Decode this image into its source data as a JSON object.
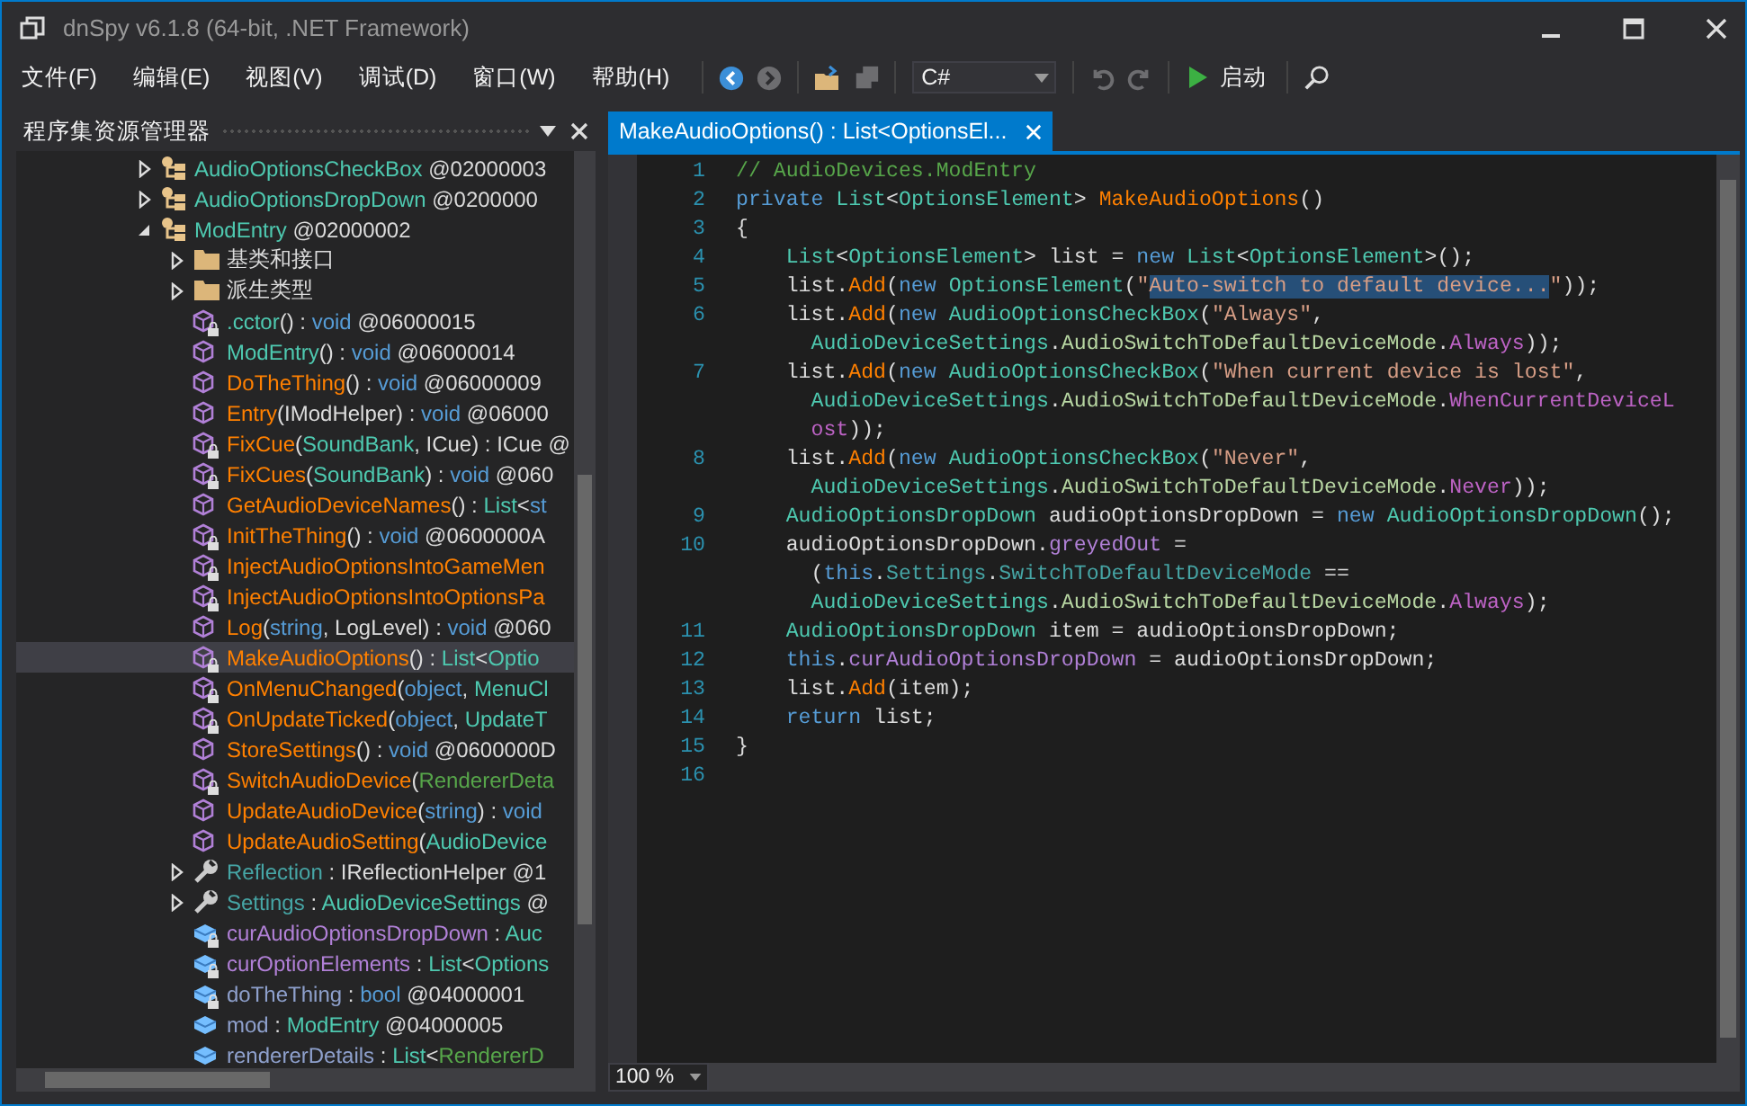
{
  "window": {
    "title": "dnSpy v6.1.8 (64-bit, .NET Framework)"
  },
  "menu": [
    "文件(F)",
    "编辑(E)",
    "视图(V)",
    "调试(D)",
    "窗口(W)",
    "帮助(H)"
  ],
  "toolbar": {
    "language": "C#",
    "start": "启动"
  },
  "explorer": {
    "title": "程序集资源管理器",
    "tree": [
      {
        "kind": "class",
        "expanded": false,
        "selected": false,
        "private": false,
        "label": [
          {
            "t": "AudioOptionsCheckBox",
            "kind": "type"
          },
          {
            "t": " @02000003",
            "kind": "plain"
          }
        ]
      },
      {
        "kind": "class",
        "expanded": false,
        "selected": false,
        "private": false,
        "label": [
          {
            "t": "AudioOptionsDropDown",
            "kind": "type"
          },
          {
            "t": " @0200000",
            "kind": "plain"
          }
        ]
      },
      {
        "kind": "class",
        "expanded": true,
        "selected": false,
        "private": false,
        "label": [
          {
            "t": "ModEntry",
            "kind": "type"
          },
          {
            "t": " @02000002",
            "kind": "plain"
          }
        ],
        "children": [
          {
            "kind": "folder",
            "expanded": false,
            "selected": false,
            "private": false,
            "label": [
              {
                "t": "基类和接口",
                "kind": "plain"
              }
            ]
          },
          {
            "kind": "folder",
            "expanded": false,
            "selected": false,
            "private": false,
            "label": [
              {
                "t": "派生类型",
                "kind": "plain"
              }
            ]
          },
          {
            "kind": "method",
            "selected": false,
            "private": true,
            "label": [
              {
                "t": ".cctor",
                "kind": "type"
              },
              {
                "t": "() : ",
                "kind": "plain"
              },
              {
                "t": "void",
                "kind": "keyword"
              },
              {
                "t": " @06000015",
                "kind": "plain"
              }
            ]
          },
          {
            "kind": "method",
            "selected": false,
            "private": false,
            "label": [
              {
                "t": "ModEntry",
                "kind": "type"
              },
              {
                "t": "() : ",
                "kind": "plain"
              },
              {
                "t": "void",
                "kind": "keyword"
              },
              {
                "t": " @06000014",
                "kind": "plain"
              }
            ]
          },
          {
            "kind": "method",
            "selected": false,
            "private": false,
            "label": [
              {
                "t": "DoTheThing",
                "kind": "method"
              },
              {
                "t": "() : ",
                "kind": "plain"
              },
              {
                "t": "void",
                "kind": "keyword"
              },
              {
                "t": " @06000009",
                "kind": "plain"
              }
            ]
          },
          {
            "kind": "method",
            "selected": false,
            "private": false,
            "label": [
              {
                "t": "Entry",
                "kind": "method"
              },
              {
                "t": "(IModHelper) : ",
                "kind": "plain"
              },
              {
                "t": "void",
                "kind": "keyword"
              },
              {
                "t": " @06000",
                "kind": "plain"
              }
            ]
          },
          {
            "kind": "method",
            "selected": false,
            "private": true,
            "label": [
              {
                "t": "FixCue",
                "kind": "method"
              },
              {
                "t": "(",
                "kind": "plain"
              },
              {
                "t": "SoundBank",
                "kind": "type"
              },
              {
                "t": ", ICue) : ICue @",
                "kind": "plain"
              }
            ]
          },
          {
            "kind": "method",
            "selected": false,
            "private": true,
            "label": [
              {
                "t": "FixCues",
                "kind": "method"
              },
              {
                "t": "(",
                "kind": "plain"
              },
              {
                "t": "SoundBank",
                "kind": "type"
              },
              {
                "t": ") : ",
                "kind": "plain"
              },
              {
                "t": "void",
                "kind": "keyword"
              },
              {
                "t": " @060",
                "kind": "plain"
              }
            ]
          },
          {
            "kind": "method",
            "selected": false,
            "private": false,
            "label": [
              {
                "t": "GetAudioDeviceNames",
                "kind": "method"
              },
              {
                "t": "() : ",
                "kind": "plain"
              },
              {
                "t": "List",
                "kind": "type"
              },
              {
                "t": "<",
                "kind": "plain"
              },
              {
                "t": "st",
                "kind": "keyword"
              }
            ]
          },
          {
            "kind": "method",
            "selected": false,
            "private": true,
            "label": [
              {
                "t": "InitTheThing",
                "kind": "method"
              },
              {
                "t": "() : ",
                "kind": "plain"
              },
              {
                "t": "void",
                "kind": "keyword"
              },
              {
                "t": " @0600000A",
                "kind": "plain"
              }
            ]
          },
          {
            "kind": "method",
            "selected": false,
            "private": true,
            "label": [
              {
                "t": "InjectAudioOptionsIntoGameMen",
                "kind": "method"
              }
            ]
          },
          {
            "kind": "method",
            "selected": false,
            "private": true,
            "label": [
              {
                "t": "InjectAudioOptionsIntoOptionsPa",
                "kind": "method"
              }
            ]
          },
          {
            "kind": "method",
            "selected": false,
            "private": false,
            "label": [
              {
                "t": "Log",
                "kind": "method"
              },
              {
                "t": "(",
                "kind": "plain"
              },
              {
                "t": "string",
                "kind": "keyword"
              },
              {
                "t": ", LogLevel) : ",
                "kind": "plain"
              },
              {
                "t": "void",
                "kind": "keyword"
              },
              {
                "t": " @060",
                "kind": "plain"
              }
            ]
          },
          {
            "kind": "method",
            "selected": true,
            "private": true,
            "label": [
              {
                "t": "MakeAudioOptions",
                "kind": "method"
              },
              {
                "t": "() : ",
                "kind": "plain"
              },
              {
                "t": "List",
                "kind": "type"
              },
              {
                "t": "<",
                "kind": "plain"
              },
              {
                "t": "Optio",
                "kind": "type"
              }
            ]
          },
          {
            "kind": "method",
            "selected": false,
            "private": true,
            "label": [
              {
                "t": "OnMenuChanged",
                "kind": "method"
              },
              {
                "t": "(",
                "kind": "plain"
              },
              {
                "t": "object",
                "kind": "keyword"
              },
              {
                "t": ", ",
                "kind": "plain"
              },
              {
                "t": "MenuCl",
                "kind": "type"
              }
            ]
          },
          {
            "kind": "method",
            "selected": false,
            "private": true,
            "label": [
              {
                "t": "OnUpdateTicked",
                "kind": "method"
              },
              {
                "t": "(",
                "kind": "plain"
              },
              {
                "t": "object",
                "kind": "keyword"
              },
              {
                "t": ", ",
                "kind": "plain"
              },
              {
                "t": "UpdateT",
                "kind": "type"
              }
            ]
          },
          {
            "kind": "method",
            "selected": false,
            "private": false,
            "label": [
              {
                "t": "StoreSettings",
                "kind": "method"
              },
              {
                "t": "() : ",
                "kind": "plain"
              },
              {
                "t": "void",
                "kind": "keyword"
              },
              {
                "t": " @0600000D",
                "kind": "plain"
              }
            ]
          },
          {
            "kind": "method",
            "selected": false,
            "private": true,
            "label": [
              {
                "t": "SwitchAudioDevice",
                "kind": "method"
              },
              {
                "t": "(",
                "kind": "plain"
              },
              {
                "t": "RendererDeta",
                "kind": "struct"
              }
            ]
          },
          {
            "kind": "method",
            "selected": false,
            "private": false,
            "label": [
              {
                "t": "UpdateAudioDevice",
                "kind": "method"
              },
              {
                "t": "(",
                "kind": "plain"
              },
              {
                "t": "string",
                "kind": "keyword"
              },
              {
                "t": ") : ",
                "kind": "plain"
              },
              {
                "t": "void",
                "kind": "keyword"
              }
            ]
          },
          {
            "kind": "method",
            "selected": false,
            "private": false,
            "label": [
              {
                "t": "UpdateAudioSetting",
                "kind": "method"
              },
              {
                "t": "(",
                "kind": "plain"
              },
              {
                "t": "AudioDevice",
                "kind": "type"
              }
            ]
          },
          {
            "kind": "property",
            "expanded": false,
            "selected": false,
            "private": false,
            "label": [
              {
                "t": "Reflection",
                "kind": "property"
              },
              {
                "t": " : IReflectionHelper @1",
                "kind": "plain"
              }
            ]
          },
          {
            "kind": "property",
            "expanded": false,
            "selected": false,
            "private": false,
            "label": [
              {
                "t": "Settings",
                "kind": "property"
              },
              {
                "t": " : ",
                "kind": "plain"
              },
              {
                "t": "AudioDeviceSettings",
                "kind": "type"
              },
              {
                "t": " @",
                "kind": "plain"
              }
            ]
          },
          {
            "kind": "field",
            "selected": false,
            "private": true,
            "label": [
              {
                "t": "curAudioOptionsDropDown",
                "kind": "field"
              },
              {
                "t": " : ",
                "kind": "plain"
              },
              {
                "t": "Auc",
                "kind": "type"
              }
            ]
          },
          {
            "kind": "field",
            "selected": false,
            "private": true,
            "label": [
              {
                "t": "curOptionElements",
                "kind": "field"
              },
              {
                "t": " : ",
                "kind": "plain"
              },
              {
                "t": "List",
                "kind": "type"
              },
              {
                "t": "<",
                "kind": "plain"
              },
              {
                "t": "Options",
                "kind": "type"
              }
            ]
          },
          {
            "kind": "field",
            "selected": false,
            "private": true,
            "label": [
              {
                "t": "doTheThing",
                "kind": "static"
              },
              {
                "t": " : ",
                "kind": "plain"
              },
              {
                "t": "bool",
                "kind": "keyword"
              },
              {
                "t": " @04000001",
                "kind": "plain"
              }
            ]
          },
          {
            "kind": "field",
            "selected": false,
            "private": false,
            "label": [
              {
                "t": "mod",
                "kind": "static"
              },
              {
                "t": " : ",
                "kind": "plain"
              },
              {
                "t": "ModEntry",
                "kind": "type"
              },
              {
                "t": " @04000005",
                "kind": "plain"
              }
            ]
          },
          {
            "kind": "field",
            "selected": false,
            "private": false,
            "label": [
              {
                "t": "rendererDetails",
                "kind": "static"
              },
              {
                "t": " : ",
                "kind": "plain"
              },
              {
                "t": "List",
                "kind": "type"
              },
              {
                "t": "<",
                "kind": "plain"
              },
              {
                "t": "RendererD",
                "kind": "struct"
              }
            ]
          }
        ]
      }
    ]
  },
  "editor": {
    "tab": "MakeAudioOptions() : List<OptionsEl...",
    "zoom": "100 %",
    "lines": [
      {
        "num": "1",
        "kind": "top",
        "tokens": [
          {
            "t": "// AudioDevices.ModEntry",
            "kind": "comment"
          }
        ]
      },
      {
        "num": "2",
        "kind": "top",
        "tokens": [
          {
            "t": "private ",
            "kind": "keyword"
          },
          {
            "t": "List",
            "kind": "type"
          },
          {
            "t": "<",
            "kind": "plain"
          },
          {
            "t": "OptionsElement",
            "kind": "type"
          },
          {
            "t": "> ",
            "kind": "plain"
          },
          {
            "t": "MakeAudioOptions",
            "kind": "method"
          },
          {
            "t": "()",
            "kind": "plain"
          }
        ]
      },
      {
        "num": "3",
        "kind": "top",
        "tokens": [
          {
            "t": "{",
            "kind": "plain"
          }
        ]
      },
      {
        "num": "4",
        "kind": "body",
        "tokens": [
          {
            "t": "List",
            "kind": "type"
          },
          {
            "t": "<",
            "kind": "plain"
          },
          {
            "t": "OptionsElement",
            "kind": "type"
          },
          {
            "t": "> list = ",
            "kind": "plain"
          },
          {
            "t": "new ",
            "kind": "keyword"
          },
          {
            "t": "List",
            "kind": "type"
          },
          {
            "t": "<",
            "kind": "plain"
          },
          {
            "t": "OptionsElement",
            "kind": "type"
          },
          {
            "t": ">();",
            "kind": "plain"
          }
        ]
      },
      {
        "num": "5",
        "kind": "body",
        "tokens": [
          {
            "t": "list.",
            "kind": "plain"
          },
          {
            "t": "Add",
            "kind": "method"
          },
          {
            "t": "(",
            "kind": "plain"
          },
          {
            "t": "new ",
            "kind": "keyword"
          },
          {
            "t": "OptionsElement",
            "kind": "type"
          },
          {
            "t": "(",
            "kind": "plain"
          },
          {
            "t": "\"",
            "kind": "string"
          },
          {
            "t": "Auto-switch to default device...",
            "kind": "selection"
          },
          {
            "t": "\"",
            "kind": "string"
          },
          {
            "t": "));",
            "kind": "plain"
          }
        ]
      },
      {
        "num": "6",
        "kind": "body",
        "tokens": [
          {
            "t": "list.",
            "kind": "plain"
          },
          {
            "t": "Add",
            "kind": "method"
          },
          {
            "t": "(",
            "kind": "plain"
          },
          {
            "t": "new ",
            "kind": "keyword"
          },
          {
            "t": "AudioOptionsCheckBox",
            "kind": "type"
          },
          {
            "t": "(",
            "kind": "plain"
          },
          {
            "t": "\"Always\"",
            "kind": "string"
          },
          {
            "t": ",",
            "kind": "plain"
          }
        ]
      },
      {
        "kind": "wrap",
        "tokens": [
          {
            "t": "AudioDeviceSettings",
            "kind": "type"
          },
          {
            "t": ".",
            "kind": "plain"
          },
          {
            "t": "AudioSwitchToDefaultDeviceMode",
            "kind": "enum"
          },
          {
            "t": ".",
            "kind": "plain"
          },
          {
            "t": "Always",
            "kind": "member"
          },
          {
            "t": "));",
            "kind": "plain"
          }
        ]
      },
      {
        "num": "7",
        "kind": "body",
        "tokens": [
          {
            "t": "list.",
            "kind": "plain"
          },
          {
            "t": "Add",
            "kind": "method"
          },
          {
            "t": "(",
            "kind": "plain"
          },
          {
            "t": "new ",
            "kind": "keyword"
          },
          {
            "t": "AudioOptionsCheckBox",
            "kind": "type"
          },
          {
            "t": "(",
            "kind": "plain"
          },
          {
            "t": "\"When current device is lost\"",
            "kind": "string"
          },
          {
            "t": ",",
            "kind": "plain"
          }
        ]
      },
      {
        "kind": "wrap",
        "tokens": [
          {
            "t": "AudioDeviceSettings",
            "kind": "type"
          },
          {
            "t": ".",
            "kind": "plain"
          },
          {
            "t": "AudioSwitchToDefaultDeviceMode",
            "kind": "enum"
          },
          {
            "t": ".",
            "kind": "plain"
          },
          {
            "t": "WhenCurrentDeviceL",
            "kind": "member"
          }
        ]
      },
      {
        "kind": "wrap",
        "tokens": [
          {
            "t": "ost",
            "kind": "member"
          },
          {
            "t": "));",
            "kind": "plain"
          }
        ]
      },
      {
        "num": "8",
        "kind": "body",
        "tokens": [
          {
            "t": "list.",
            "kind": "plain"
          },
          {
            "t": "Add",
            "kind": "method"
          },
          {
            "t": "(",
            "kind": "plain"
          },
          {
            "t": "new ",
            "kind": "keyword"
          },
          {
            "t": "AudioOptionsCheckBox",
            "kind": "type"
          },
          {
            "t": "(",
            "kind": "plain"
          },
          {
            "t": "\"Never\"",
            "kind": "string"
          },
          {
            "t": ",",
            "kind": "plain"
          }
        ]
      },
      {
        "kind": "wrap",
        "tokens": [
          {
            "t": "AudioDeviceSettings",
            "kind": "type"
          },
          {
            "t": ".",
            "kind": "plain"
          },
          {
            "t": "AudioSwitchToDefaultDeviceMode",
            "kind": "enum"
          },
          {
            "t": ".",
            "kind": "plain"
          },
          {
            "t": "Never",
            "kind": "member"
          },
          {
            "t": "));",
            "kind": "plain"
          }
        ]
      },
      {
        "num": "9",
        "kind": "body",
        "tokens": [
          {
            "t": "AudioOptionsDropDown",
            "kind": "type"
          },
          {
            "t": " audioOptionsDropDown = ",
            "kind": "plain"
          },
          {
            "t": "new ",
            "kind": "keyword"
          },
          {
            "t": "AudioOptionsDropDown",
            "kind": "type"
          },
          {
            "t": "();",
            "kind": "plain"
          }
        ]
      },
      {
        "num": "10",
        "kind": "body",
        "tokens": [
          {
            "t": "audioOptionsDropDown.",
            "kind": "plain"
          },
          {
            "t": "greyedOut",
            "kind": "field"
          },
          {
            "t": " =",
            "kind": "plain"
          }
        ]
      },
      {
        "kind": "wrap",
        "tokens": [
          {
            "t": "(",
            "kind": "plain"
          },
          {
            "t": "this",
            "kind": "keyword"
          },
          {
            "t": ".",
            "kind": "plain"
          },
          {
            "t": "Settings",
            "kind": "property"
          },
          {
            "t": ".",
            "kind": "plain"
          },
          {
            "t": "SwitchToDefaultDeviceMode",
            "kind": "property"
          },
          {
            "t": " ==",
            "kind": "plain"
          }
        ]
      },
      {
        "kind": "wrap",
        "tokens": [
          {
            "t": "AudioDeviceSettings",
            "kind": "type"
          },
          {
            "t": ".",
            "kind": "plain"
          },
          {
            "t": "AudioSwitchToDefaultDeviceMode",
            "kind": "enum"
          },
          {
            "t": ".",
            "kind": "plain"
          },
          {
            "t": "Always",
            "kind": "member"
          },
          {
            "t": ");",
            "kind": "plain"
          }
        ]
      },
      {
        "num": "11",
        "kind": "body",
        "tokens": [
          {
            "t": "AudioOptionsDropDown",
            "kind": "type"
          },
          {
            "t": " item = audioOptionsDropDown;",
            "kind": "plain"
          }
        ]
      },
      {
        "num": "12",
        "kind": "body",
        "tokens": [
          {
            "t": "this",
            "kind": "keyword"
          },
          {
            "t": ".",
            "kind": "plain"
          },
          {
            "t": "curAudioOptionsDropDown",
            "kind": "field"
          },
          {
            "t": " = audioOptionsDropDown;",
            "kind": "plain"
          }
        ]
      },
      {
        "num": "13",
        "kind": "body",
        "tokens": [
          {
            "t": "list.",
            "kind": "plain"
          },
          {
            "t": "Add",
            "kind": "method"
          },
          {
            "t": "(item);",
            "kind": "plain"
          }
        ]
      },
      {
        "num": "14",
        "kind": "body",
        "tokens": [
          {
            "t": "return",
            "kind": "keyword"
          },
          {
            "t": " list;",
            "kind": "plain"
          }
        ]
      },
      {
        "num": "15",
        "kind": "top",
        "tokens": [
          {
            "t": "}",
            "kind": "plain"
          }
        ]
      },
      {
        "num": "16"
      }
    ]
  }
}
